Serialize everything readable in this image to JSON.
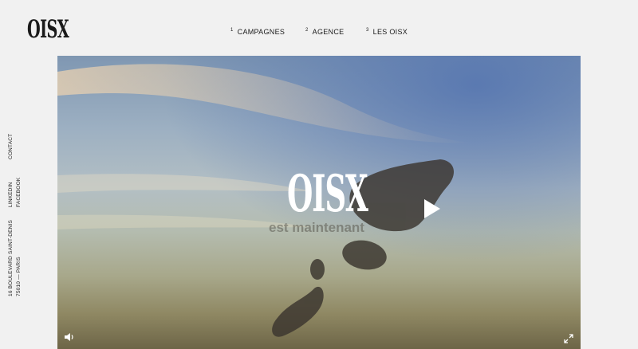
{
  "brand": {
    "logo": "OISX"
  },
  "nav": [
    {
      "num": "1",
      "label": "CAMPAGNES"
    },
    {
      "num": "2",
      "label": "AGENCE"
    },
    {
      "num": "3",
      "label": "LES OISX"
    }
  ],
  "sidebar": {
    "contact": "CONTACT",
    "linkedin": "LINKEDIN",
    "facebook": "FACEBOOK",
    "address_line1": "16 BOULEVARD SAINT-DENIS",
    "address_line2": "75010 — PARIS"
  },
  "video": {
    "overlay_logo": "OISX",
    "overlay_text": "est maintenant",
    "play_icon": "play-icon",
    "volume_icon": "volume-icon",
    "fullscreen_icon": "fullscreen-icon"
  }
}
